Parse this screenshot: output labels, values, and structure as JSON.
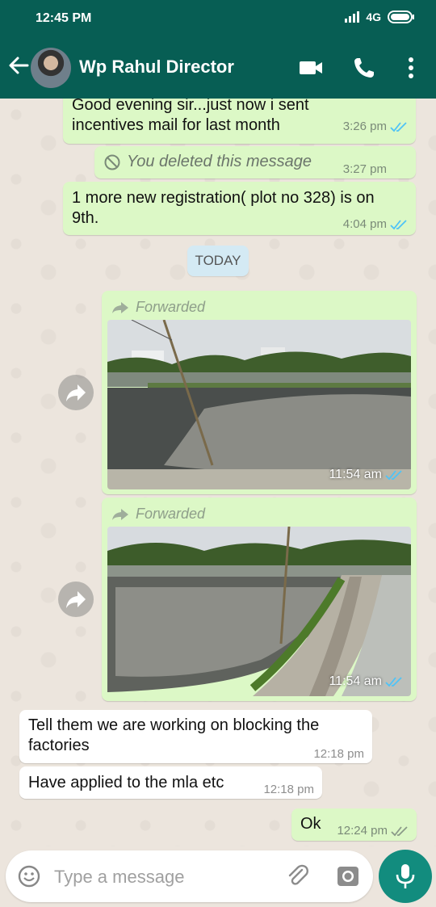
{
  "status_bar": {
    "time": "12:45 PM",
    "network": "4G"
  },
  "header": {
    "contact_name": "Wp Rahul Director"
  },
  "messages": [
    {
      "text": "Good evening sir...just now i sent incentives mail for last month",
      "time": "3:26 pm"
    },
    {
      "text": "You deleted this message",
      "time": "3:27 pm"
    },
    {
      "text": "1 more new registration( plot no 328)  is on 9th.",
      "time": "4:04 pm"
    },
    {
      "date_divider": "TODAY"
    },
    {
      "label": "Forwarded",
      "time": "11:54 am"
    },
    {
      "label": "Forwarded",
      "time": "11:54 am"
    },
    {
      "text": "Tell them we are working on blocking the factories",
      "time": "12:18 pm"
    },
    {
      "text": "Have applied to the mla etc",
      "time": "12:18 pm"
    },
    {
      "text": "Ok",
      "time": "12:24 pm"
    }
  ],
  "composer": {
    "placeholder": "Type a message"
  },
  "colors": {
    "header": "#075e54",
    "outgoing": "#dcf8c6",
    "incoming": "#ffffff",
    "accent": "#128c7e",
    "read_ticks": "#4fc3f7"
  }
}
